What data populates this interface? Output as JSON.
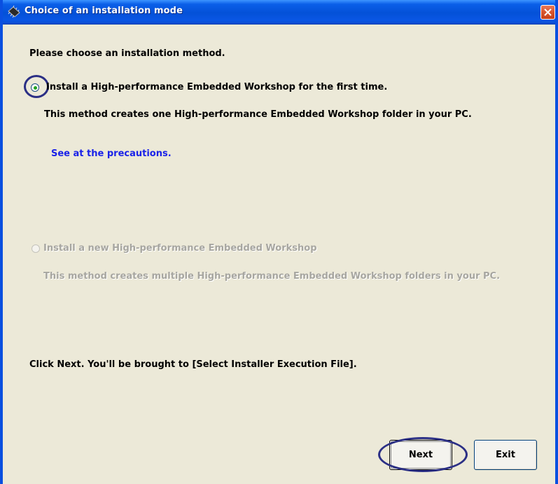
{
  "window": {
    "title": "Choice of an installation mode",
    "icon": "chip-icon",
    "close_glyph": "×"
  },
  "prompt": "Please choose an installation method.",
  "options": [
    {
      "label": "Install a High-performance Embedded Workshop for the first time.",
      "description": "This method creates one High-performance Embedded Workshop folder in your PC.",
      "selected": true,
      "enabled": true
    },
    {
      "label": "Install a new High-performance Embedded Workshop",
      "description": "This method creates multiple High-performance Embedded Workshop folders in your PC.",
      "selected": false,
      "enabled": false
    }
  ],
  "precautions_link": "See at the precautions.",
  "instruction": "Click Next. You'll be brought to [Select Installer Execution File].",
  "buttons": {
    "next": "Next",
    "exit": "Exit"
  },
  "colors": {
    "titlebar": "#0451d8",
    "window_bg": "#ece9d8",
    "link": "#1a22e8",
    "annotation": "#2b2f85"
  }
}
